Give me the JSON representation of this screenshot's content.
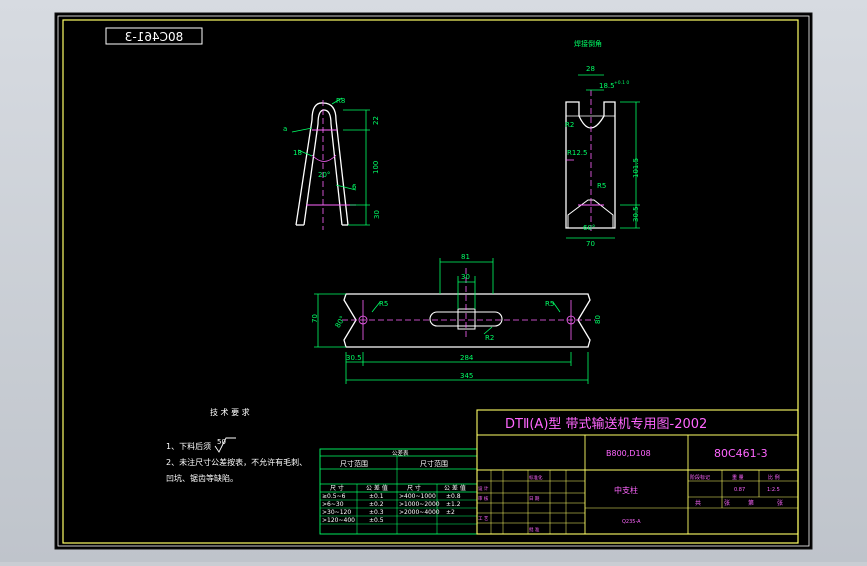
{
  "stamp": "80C461-3",
  "views": {
    "view1": {
      "d_r8": "R8",
      "d_a": "a",
      "d_18": "18",
      "d_22": "22",
      "d_100": "100",
      "d_20deg": "20°",
      "d_6": "6",
      "d_30": "30"
    },
    "view2": {
      "label": "焊接倒角",
      "d_28": "28",
      "d_185": "18.5",
      "tol_185": "+0.1 0",
      "d_r2": "R2",
      "d_r125": "R12.5",
      "d_r5": "R5",
      "d_1015": "101.5",
      "d_305": "30.5",
      "d_60deg": "60°",
      "d_70": "70"
    },
    "view3": {
      "d_81": "81",
      "d_30": "30",
      "d_70": "70",
      "d_r5l": "R5",
      "d_r5r": "R5",
      "d_80l": "80°",
      "d_80r": "80",
      "d_r2": "R2",
      "d_305": "30.5",
      "d_284": "284",
      "d_345": "345"
    }
  },
  "notes": {
    "title": "技 术 要 求",
    "line1": "1、下料后须",
    "roughness": "50",
    "line2": "2、未注尺寸公差按表，不允许有毛刺、",
    "line3": "凹坑、锯齿等缺陷。"
  },
  "tolerance_table": {
    "title": "公差表",
    "header_left": "尺寸范围",
    "header_right": "尺寸范围",
    "sub_a": "尺 寸",
    "sub_b": "公 差 值",
    "sub_c": "尺 寸",
    "sub_d": "公 差 值",
    "rows": [
      [
        "≥0.5~6",
        "±0.1",
        ">400~1000",
        "±0.8"
      ],
      [
        ">6~30",
        "±0.2",
        ">1000~2000",
        "±1.2"
      ],
      [
        ">30~120",
        "±0.3",
        ">2000~4000",
        "±2"
      ],
      [
        ">120~400",
        "±0.5",
        "",
        ""
      ]
    ]
  },
  "title_block": {
    "title": "DTⅡ(A)型  带式输送机专用图-2002",
    "spec": "B800,D108",
    "drawing_no": "80C461-3",
    "part_name": "中支柱",
    "material": "Q235-A",
    "mass_label": "重 量",
    "scale_label": "比 例",
    "stage_label": "阶段标记",
    "mass": "0.87",
    "scale": "1:2.5",
    "sheet_a": "共",
    "sheet_b": "张",
    "sheet_c": "第",
    "sheet_d": "张",
    "designer": "设 计",
    "checker": "审 核",
    "approver": "批 准",
    "standard": "标准化",
    "proc": "工 艺",
    "date": "日 期"
  }
}
